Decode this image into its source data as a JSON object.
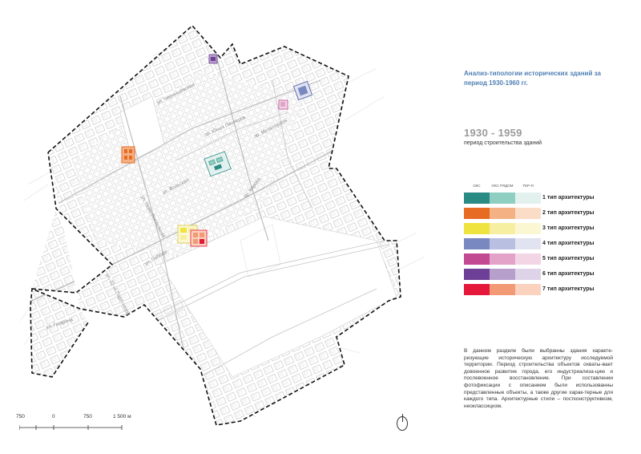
{
  "title": "Анализ-типологии исторических зданий за период 1930-1960 гг.",
  "period": {
    "range": "1930 - 1959",
    "caption": "период строительства зданий"
  },
  "legend": {
    "columns": [
      "ОКС",
      "ОКС РЯДОМ",
      "ТЕР-Я"
    ],
    "rows": [
      {
        "label": "1 тип архитектуры",
        "colors": [
          "#2a8a84",
          "#8fcfc2",
          "#e2f1ee"
        ]
      },
      {
        "label": "2 тип архитектуры",
        "colors": [
          "#e86b24",
          "#f3b184",
          "#fbdcc6"
        ]
      },
      {
        "label": "3 тип архитектуры",
        "colors": [
          "#efe33f",
          "#f6efa1",
          "#fbf7d3"
        ]
      },
      {
        "label": "4 тип архитектуры",
        "colors": [
          "#7a88c2",
          "#b9bfe1",
          "#e1e3f1"
        ]
      },
      {
        "label": "5 тип архитектуры",
        "colors": [
          "#c24a92",
          "#e3a3c8",
          "#f2d6e6"
        ]
      },
      {
        "label": "6 тип архитектуры",
        "colors": [
          "#6e3f96",
          "#b6a0cb",
          "#ded3e8"
        ]
      },
      {
        "label": "7 тип архитектуры",
        "colors": [
          "#e5173a",
          "#f29a76",
          "#fad2bd"
        ]
      }
    ]
  },
  "description": "В данном разделе были выбранны здания характе-ризующие историческую архитектуру исследуемой территории. Период строительства объектов охваты-вает довоенное развитие города, его индустриализа-цию и послевоенное восстановление. При составлении фотофиксации с описанием были использованны представленные объекты, а также другие харак-терные для каждого типа. Архитектурные стили – постконструктивизм, неоклассицизм.",
  "scale": {
    "labels": [
      "750",
      "0",
      "750",
      "1 500 м"
    ]
  },
  "map": {
    "streets": [
      "ул. Чернышевская",
      "пр. Юных Пионеров",
      "пр. Металлургов",
      "ул. Вольская",
      "пр. Кирова",
      "ул. Ново-Вокзальная",
      "ул. Победы",
      "ул. 22-го Партсъезда",
      "ул. Гагарина"
    ],
    "highlighted_buildings": [
      {
        "type": "2 тип архитектуры",
        "color": "#e86b24"
      },
      {
        "type": "1 тип архитектуры",
        "color": "#2a8a84"
      },
      {
        "type": "3 тип архитектуры",
        "color": "#efe33f"
      },
      {
        "type": "7 тип архитектуры",
        "color": "#f29a76"
      },
      {
        "type": "6 тип архитектуры",
        "color": "#6e3f96"
      },
      {
        "type": "4 тип архитектуры",
        "color": "#7a88c2"
      },
      {
        "type": "5 тип архитектуры",
        "color": "#c24a92"
      }
    ]
  }
}
